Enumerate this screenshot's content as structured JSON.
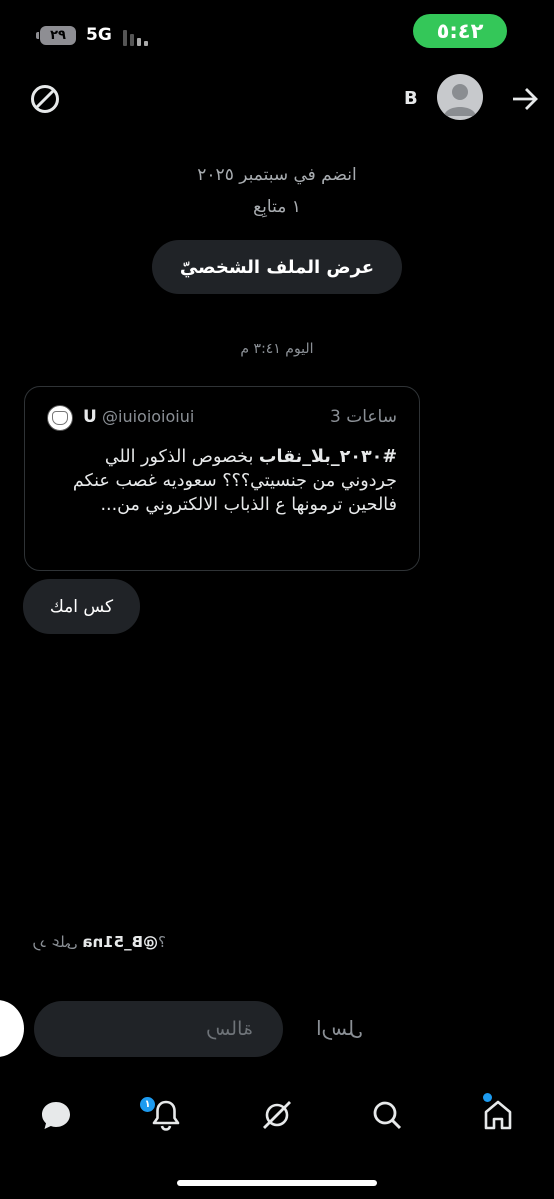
{
  "status_bar": {
    "time": "٥:٤٢",
    "battery": "٢٩",
    "network": "5G"
  },
  "header": {
    "name": "B",
    "back_icon": "arrow-right-icon",
    "block_icon": "block-icon"
  },
  "profile": {
    "joined": "انضم في سبتمبر ٢٠٢٥",
    "followers": "١ متابِع",
    "view_profile_label": "عرض الملف الشخصيّ"
  },
  "conversation": {
    "timestamp": "اليوم ٣:٤١ م",
    "quoted_tweet": {
      "name": "U",
      "handle": "@iuioioioiui",
      "time": "3 ساعات",
      "hashtag": "#٢٠٣٠_بلا_نقاب",
      "text_rest": " بخصوص الذكور اللي جردوني من جنسيتي؟؟؟ سعوديه غصب عنكم",
      "text_last": "فالحين ترمونها ع الذباب الالكتروني من..."
    },
    "message": "كس امك"
  },
  "reply_context": {
    "prefix": "?",
    "handle": "@B_51na",
    "label": "رد على"
  },
  "compose": {
    "placeholder": "رسالة",
    "send_label": "ارسل"
  },
  "nav": {
    "notifications_badge": "١",
    "items": [
      "messages-icon",
      "notifications-icon",
      "grok-icon",
      "search-icon",
      "home-icon"
    ]
  },
  "colors": {
    "accent": "#1d9bf0",
    "status_time_bg": "#34c759",
    "bubble_bg": "#202327"
  }
}
